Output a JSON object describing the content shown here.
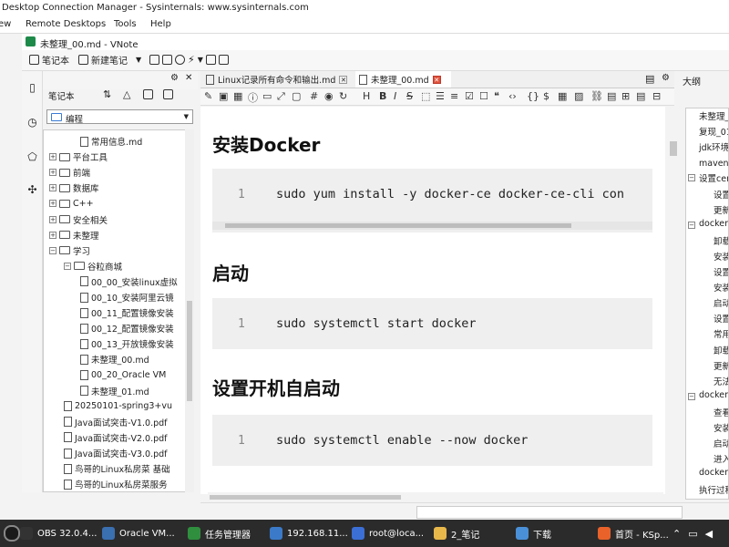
{
  "outer_window": {
    "title": "Desktop Connection Manager - Sysinternals: www.sysinternals.com",
    "menu": [
      "ew",
      "Remote Desktops",
      "Tools",
      "Help"
    ]
  },
  "vnote": {
    "title": "未整理_00.md - VNote",
    "toolbar": {
      "notebook_label": "笔记本",
      "new_note_label": "新建笔记"
    },
    "notebook_panel": {
      "header": "笔记本",
      "current_notebook": "编程",
      "tree": [
        {
          "label": "常用信息.md",
          "type": "file",
          "depth": 2
        },
        {
          "label": "平台工具",
          "type": "folder",
          "depth": 0,
          "toggle": "+"
        },
        {
          "label": "前端",
          "type": "folder",
          "depth": 0,
          "toggle": "+"
        },
        {
          "label": "数据库",
          "type": "folder",
          "depth": 0,
          "toggle": "+"
        },
        {
          "label": "C++",
          "type": "folder",
          "depth": 0,
          "toggle": "+"
        },
        {
          "label": "安全相关",
          "type": "folder",
          "depth": 0,
          "toggle": "+"
        },
        {
          "label": "未整理",
          "type": "folder",
          "depth": 0,
          "toggle": "+"
        },
        {
          "label": "学习",
          "type": "folder",
          "depth": 0,
          "toggle": "-"
        },
        {
          "label": "谷粒商城",
          "type": "folder",
          "depth": 1,
          "toggle": "-"
        },
        {
          "label": "00_00_安装linux虚拟",
          "type": "file",
          "depth": 2
        },
        {
          "label": "00_10_安装阿里云镜",
          "type": "file",
          "depth": 2
        },
        {
          "label": "00_11_配置镜像安装",
          "type": "file",
          "depth": 2
        },
        {
          "label": "00_12_配置镜像安装",
          "type": "file",
          "depth": 2
        },
        {
          "label": "00_13_开放镜像安装",
          "type": "file",
          "depth": 2
        },
        {
          "label": "未整理_00.md",
          "type": "file",
          "depth": 2
        },
        {
          "label": "00_20_Oracle VM",
          "type": "file",
          "depth": 2
        },
        {
          "label": "未整理_01.md",
          "type": "file",
          "depth": 2
        },
        {
          "label": "20250101-spring3+vu",
          "type": "file",
          "depth": 1
        },
        {
          "label": "Java面试突击-V1.0.pdf",
          "type": "file",
          "depth": 1
        },
        {
          "label": "Java面试突击-V2.0.pdf",
          "type": "file",
          "depth": 1
        },
        {
          "label": "Java面试突击-V3.0.pdf",
          "type": "file",
          "depth": 1
        },
        {
          "label": "鸟哥的Linux私房菜 基础",
          "type": "file",
          "depth": 1
        },
        {
          "label": "鸟哥的Linux私房菜服务",
          "type": "file",
          "depth": 1
        }
      ]
    },
    "tabs": [
      {
        "label": "Linux记录所有命令和输出.md",
        "active": false
      },
      {
        "label": "未整理_00.md",
        "active": true
      }
    ],
    "outline_header": "大纲",
    "document": [
      {
        "heading": "安装Docker",
        "line": "1",
        "code": "sudo yum install -y docker-ce docker-ce-cli con"
      },
      {
        "heading": "启动",
        "line": "1",
        "code": "sudo systemctl start docker"
      },
      {
        "heading": "设置开机自启动",
        "line": "1",
        "code": "sudo systemctl enable --now docker"
      }
    ],
    "outline": [
      {
        "label": "未整理_",
        "depth": 1
      },
      {
        "label": "复现_01",
        "depth": 1
      },
      {
        "label": "jdk环境",
        "depth": 1
      },
      {
        "label": "maven环",
        "depth": 1
      },
      {
        "label": "设置cen",
        "depth": 1,
        "toggle": "-"
      },
      {
        "label": "设置",
        "depth": 2
      },
      {
        "label": "更新",
        "depth": 2
      },
      {
        "label": "docker",
        "depth": 1,
        "toggle": "-"
      },
      {
        "label": "卸载",
        "depth": 2
      },
      {
        "label": "安装",
        "depth": 2
      },
      {
        "label": "设置",
        "depth": 2
      },
      {
        "label": "安装",
        "depth": 2
      },
      {
        "label": "启动",
        "depth": 2
      },
      {
        "label": "设置",
        "depth": 2
      },
      {
        "label": "常用",
        "depth": 2
      },
      {
        "label": "卸载",
        "depth": 2
      },
      {
        "label": "更新",
        "depth": 2
      },
      {
        "label": "无法",
        "depth": 2
      },
      {
        "label": "docker",
        "depth": 1,
        "toggle": "-"
      },
      {
        "label": "查看",
        "depth": 2
      },
      {
        "label": "安装",
        "depth": 2
      },
      {
        "label": "启动",
        "depth": 2
      },
      {
        "label": "进入",
        "depth": 2
      },
      {
        "label": "docker",
        "depth": 1
      },
      {
        "label": "执行过程",
        "depth": 1
      }
    ]
  },
  "taskbar": [
    {
      "label": "OBS 32.0.4...",
      "icon": "obs-icon",
      "color": "#333333"
    },
    {
      "label": "Oracle VM...",
      "icon": "virtualbox-icon",
      "color": "#3a6fb0"
    },
    {
      "label": "任务管理器",
      "icon": "task-manager-icon",
      "color": "#2f8f3f"
    },
    {
      "label": "192.168.11...",
      "icon": "remote-desktop-icon",
      "color": "#3b7ac8"
    },
    {
      "label": "root@loca...",
      "icon": "terminal-icon",
      "color": "#3b6fd6"
    },
    {
      "label": "2_笔记",
      "icon": "folder-icon",
      "color": "#e8b84a"
    },
    {
      "label": "下载",
      "icon": "download-icon",
      "color": "#4a90d9"
    },
    {
      "label": "首页 - KSp...",
      "icon": "firefox-icon",
      "color": "#e8622a"
    }
  ]
}
